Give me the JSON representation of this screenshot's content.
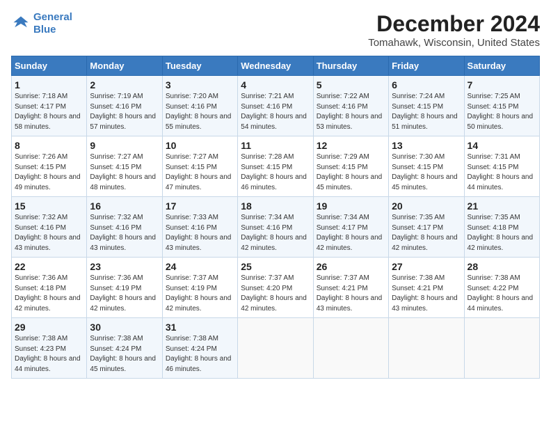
{
  "header": {
    "logo_line1": "General",
    "logo_line2": "Blue",
    "month_title": "December 2024",
    "location": "Tomahawk, Wisconsin, United States"
  },
  "days_of_week": [
    "Sunday",
    "Monday",
    "Tuesday",
    "Wednesday",
    "Thursday",
    "Friday",
    "Saturday"
  ],
  "weeks": [
    [
      {
        "day": "1",
        "sunrise": "7:18 AM",
        "sunset": "4:17 PM",
        "daylight": "8 hours and 58 minutes."
      },
      {
        "day": "2",
        "sunrise": "7:19 AM",
        "sunset": "4:16 PM",
        "daylight": "8 hours and 57 minutes."
      },
      {
        "day": "3",
        "sunrise": "7:20 AM",
        "sunset": "4:16 PM",
        "daylight": "8 hours and 55 minutes."
      },
      {
        "day": "4",
        "sunrise": "7:21 AM",
        "sunset": "4:16 PM",
        "daylight": "8 hours and 54 minutes."
      },
      {
        "day": "5",
        "sunrise": "7:22 AM",
        "sunset": "4:16 PM",
        "daylight": "8 hours and 53 minutes."
      },
      {
        "day": "6",
        "sunrise": "7:24 AM",
        "sunset": "4:15 PM",
        "daylight": "8 hours and 51 minutes."
      },
      {
        "day": "7",
        "sunrise": "7:25 AM",
        "sunset": "4:15 PM",
        "daylight": "8 hours and 50 minutes."
      }
    ],
    [
      {
        "day": "8",
        "sunrise": "7:26 AM",
        "sunset": "4:15 PM",
        "daylight": "8 hours and 49 minutes."
      },
      {
        "day": "9",
        "sunrise": "7:27 AM",
        "sunset": "4:15 PM",
        "daylight": "8 hours and 48 minutes."
      },
      {
        "day": "10",
        "sunrise": "7:27 AM",
        "sunset": "4:15 PM",
        "daylight": "8 hours and 47 minutes."
      },
      {
        "day": "11",
        "sunrise": "7:28 AM",
        "sunset": "4:15 PM",
        "daylight": "8 hours and 46 minutes."
      },
      {
        "day": "12",
        "sunrise": "7:29 AM",
        "sunset": "4:15 PM",
        "daylight": "8 hours and 45 minutes."
      },
      {
        "day": "13",
        "sunrise": "7:30 AM",
        "sunset": "4:15 PM",
        "daylight": "8 hours and 45 minutes."
      },
      {
        "day": "14",
        "sunrise": "7:31 AM",
        "sunset": "4:15 PM",
        "daylight": "8 hours and 44 minutes."
      }
    ],
    [
      {
        "day": "15",
        "sunrise": "7:32 AM",
        "sunset": "4:16 PM",
        "daylight": "8 hours and 43 minutes."
      },
      {
        "day": "16",
        "sunrise": "7:32 AM",
        "sunset": "4:16 PM",
        "daylight": "8 hours and 43 minutes."
      },
      {
        "day": "17",
        "sunrise": "7:33 AM",
        "sunset": "4:16 PM",
        "daylight": "8 hours and 43 minutes."
      },
      {
        "day": "18",
        "sunrise": "7:34 AM",
        "sunset": "4:16 PM",
        "daylight": "8 hours and 42 minutes."
      },
      {
        "day": "19",
        "sunrise": "7:34 AM",
        "sunset": "4:17 PM",
        "daylight": "8 hours and 42 minutes."
      },
      {
        "day": "20",
        "sunrise": "7:35 AM",
        "sunset": "4:17 PM",
        "daylight": "8 hours and 42 minutes."
      },
      {
        "day": "21",
        "sunrise": "7:35 AM",
        "sunset": "4:18 PM",
        "daylight": "8 hours and 42 minutes."
      }
    ],
    [
      {
        "day": "22",
        "sunrise": "7:36 AM",
        "sunset": "4:18 PM",
        "daylight": "8 hours and 42 minutes."
      },
      {
        "day": "23",
        "sunrise": "7:36 AM",
        "sunset": "4:19 PM",
        "daylight": "8 hours and 42 minutes."
      },
      {
        "day": "24",
        "sunrise": "7:37 AM",
        "sunset": "4:19 PM",
        "daylight": "8 hours and 42 minutes."
      },
      {
        "day": "25",
        "sunrise": "7:37 AM",
        "sunset": "4:20 PM",
        "daylight": "8 hours and 42 minutes."
      },
      {
        "day": "26",
        "sunrise": "7:37 AM",
        "sunset": "4:21 PM",
        "daylight": "8 hours and 43 minutes."
      },
      {
        "day": "27",
        "sunrise": "7:38 AM",
        "sunset": "4:21 PM",
        "daylight": "8 hours and 43 minutes."
      },
      {
        "day": "28",
        "sunrise": "7:38 AM",
        "sunset": "4:22 PM",
        "daylight": "8 hours and 44 minutes."
      }
    ],
    [
      {
        "day": "29",
        "sunrise": "7:38 AM",
        "sunset": "4:23 PM",
        "daylight": "8 hours and 44 minutes."
      },
      {
        "day": "30",
        "sunrise": "7:38 AM",
        "sunset": "4:24 PM",
        "daylight": "8 hours and 45 minutes."
      },
      {
        "day": "31",
        "sunrise": "7:38 AM",
        "sunset": "4:24 PM",
        "daylight": "8 hours and 46 minutes."
      },
      null,
      null,
      null,
      null
    ]
  ],
  "labels": {
    "sunrise": "Sunrise:",
    "sunset": "Sunset:",
    "daylight": "Daylight:"
  }
}
